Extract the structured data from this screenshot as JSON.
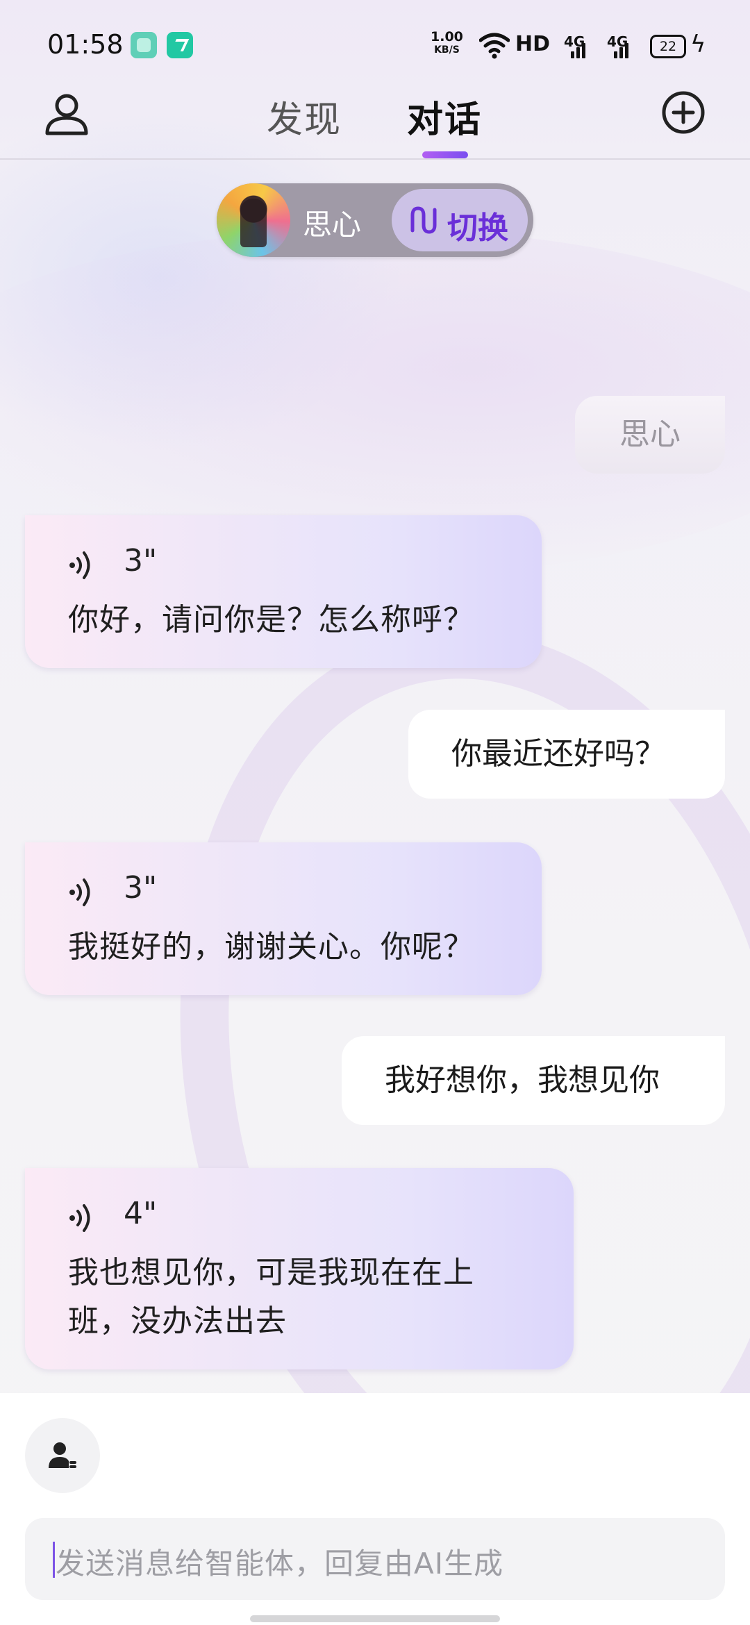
{
  "status_bar": {
    "time": "01:58",
    "net_speed_value": "1.00",
    "net_speed_unit": "KB/S",
    "hd_label": "HD",
    "signal_1": "4G",
    "signal_2": "4G",
    "battery": "22"
  },
  "header": {
    "tabs": [
      {
        "label": "发现",
        "active": false
      },
      {
        "label": "对话",
        "active": true
      }
    ]
  },
  "character": {
    "name": "思心",
    "switch_label": "切换"
  },
  "messages": [
    {
      "role": "system",
      "text": "思心"
    },
    {
      "role": "ai",
      "voice_duration": "3\"",
      "text": "你好，请问你是？怎么称呼？"
    },
    {
      "role": "user",
      "text": "你最近还好吗？"
    },
    {
      "role": "ai",
      "voice_duration": "3\"",
      "text": "我挺好的，谢谢关心。你呢？"
    },
    {
      "role": "user",
      "text": "我好想你，我想见你"
    },
    {
      "role": "ai",
      "voice_duration": "4\"",
      "text": "我也想见你，可是我现在在上班，没办法出去"
    }
  ],
  "input": {
    "placeholder": "发送消息给智能体，回复由AI生成"
  },
  "icons": {
    "profile": "person-outline-icon",
    "add": "plus-circle-icon",
    "switch": "switch-wave-icon",
    "voice": "voice-wave-icon",
    "persona": "persona-icon"
  },
  "colors": {
    "accent": "#7a4ef0",
    "switch_text": "#6a2fd8",
    "ai_bubble_start": "#fbeaf6",
    "ai_bubble_end": "#dcd6fb",
    "user_bubble": "#ffffff"
  }
}
